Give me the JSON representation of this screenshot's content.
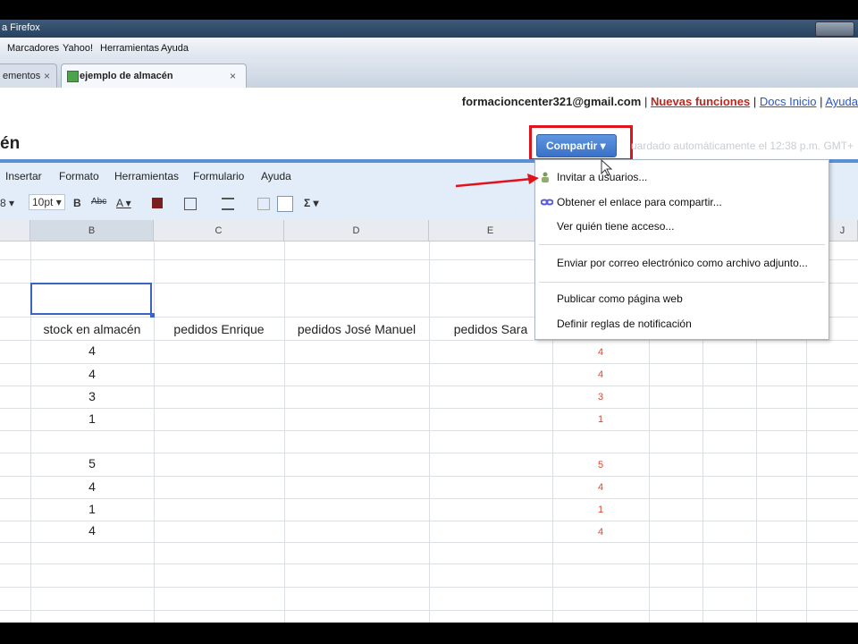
{
  "window": {
    "title_fragment": "a Firefox"
  },
  "menubar": {
    "items": [
      "Marcadores",
      "Yahoo!",
      "Herramientas",
      "Ayuda"
    ]
  },
  "tabs": [
    {
      "label": "ementos",
      "close": "×"
    },
    {
      "label": "ejemplo de almacén",
      "close": "×"
    }
  ],
  "userbar": {
    "email": "formacioncenter321@gmail.com",
    "sep": "|",
    "new_features": "Nuevas funciones",
    "docs_home": "Docs Inicio",
    "help": "Ayuda"
  },
  "document": {
    "title_fragment": "én"
  },
  "share_button": {
    "label": "Compartir ▾"
  },
  "autosave_text": "uardado automáticamente el 12:38 p.m. GMT+",
  "sheet_menu": {
    "items": [
      "Insertar",
      "Formato",
      "Herramientas",
      "Formulario",
      "Ayuda"
    ]
  },
  "toolbar": {
    "font_size": "10pt ▾",
    "bold": "B",
    "strike": "Abc",
    "text_color": "A ▾",
    "sum": "Σ ▾",
    "partial_left": "8 ▾"
  },
  "grid": {
    "columns": [
      "B",
      "C",
      "D",
      "E",
      "J"
    ],
    "headers": [
      "stock en almacén",
      "pedidos Enrique",
      "pedidos José Manuel",
      "pedidos Sara"
    ],
    "stock_values": [
      "4",
      "4",
      "3",
      "1",
      "",
      "5",
      "4",
      "1",
      "4"
    ],
    "red_values": [
      "4",
      "4",
      "3",
      "1",
      "",
      "5",
      "4",
      "1",
      "4"
    ]
  },
  "share_menu": {
    "items": [
      {
        "label": "Invitar a usuarios...",
        "icon": "users-icon"
      },
      {
        "label": "Obtener el enlace para compartir...",
        "icon": "link-icon"
      },
      {
        "label": "Ver quién tiene acceso..."
      },
      {
        "label": "Enviar por correo electrónico como archivo adjunto..."
      },
      {
        "label": "Publicar como página web"
      },
      {
        "label": "Definir reglas de notificación"
      }
    ]
  },
  "colors": {
    "accent": "#3a71c7",
    "highlight": "#e0121a",
    "link": "#2b55c7",
    "red_value": "#e2452d"
  }
}
